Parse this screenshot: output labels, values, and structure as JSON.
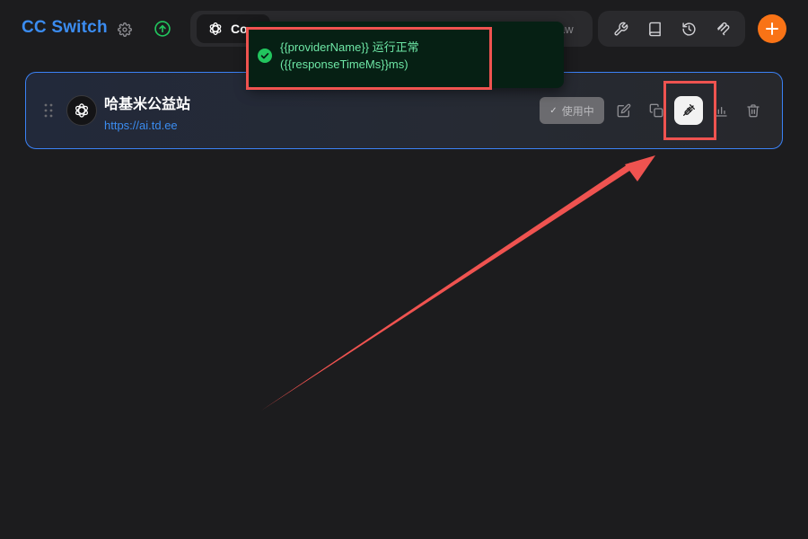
{
  "app": {
    "title": "CC Switch"
  },
  "header": {
    "settings_icon": "gear-icon",
    "update_icon": "arrow-up-circle-icon",
    "active_tab": {
      "label": "Co",
      "icon": "openai-logo-icon"
    },
    "partial_tab_label": "aw",
    "tools": [
      "wrench-icon",
      "book-icon",
      "history-icon",
      "mcp-icon"
    ],
    "add_icon": "plus-icon"
  },
  "toast": {
    "status": "success",
    "line1": "{{providerName}} 运行正常",
    "line2": "({{responseTimeMs}}ms)"
  },
  "provider": {
    "name": "哈基米公益站",
    "url": "https://ai.td.ee",
    "in_use_label": "使用中",
    "actions": [
      "edit-icon",
      "duplicate-icon",
      "test-icon",
      "usage-chart-icon",
      "trash-icon"
    ]
  },
  "colors": {
    "accent": "#3b8cf0",
    "add_button": "#f97316",
    "success": "#22c55e",
    "annotation": "#ef5350"
  }
}
